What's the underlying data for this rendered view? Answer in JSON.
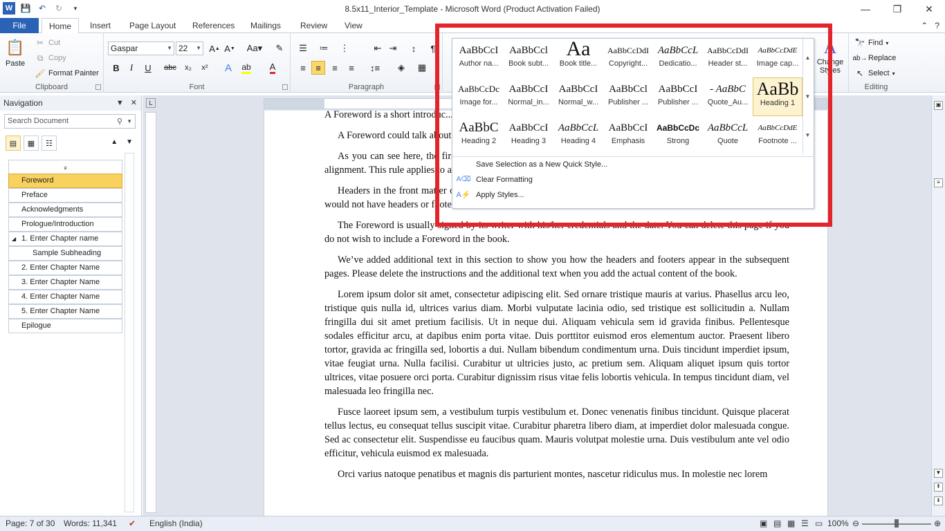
{
  "window": {
    "title": "8.5x11_Interior_Template  -  Microsoft Word (Product Activation Failed)",
    "controls": [
      "—",
      "❐",
      "✕"
    ]
  },
  "tabs": [
    "File",
    "Home",
    "Insert",
    "Page Layout",
    "References",
    "Mailings",
    "Review",
    "View"
  ],
  "ribbon": {
    "clipboard": {
      "label": "Clipboard",
      "paste": "Paste",
      "cut": "Cut",
      "copy": "Copy",
      "format_painter": "Format Painter"
    },
    "font": {
      "label": "Font",
      "family": "Gaspar",
      "size": "22",
      "bold": "B",
      "italic": "I",
      "underline": "U",
      "strike": "abc",
      "sub": "x₂",
      "sup": "x²"
    },
    "paragraph": {
      "label": "Paragraph"
    },
    "styles": {
      "change_styles": "Change Styles"
    },
    "editing": {
      "label": "Editing",
      "find": "Find",
      "replace": "Replace",
      "select": "Select"
    }
  },
  "styles_gallery": {
    "row1": [
      {
        "preview": "AaBbCcI",
        "name": "Author na..."
      },
      {
        "preview": "AaBbCcl",
        "name": "Book subt..."
      },
      {
        "preview": "Aa",
        "name": "Book title..."
      },
      {
        "preview": "AaBbCcDdI",
        "name": "Copyright..."
      },
      {
        "preview": "AaBbCcL",
        "name": "Dedicatio..."
      },
      {
        "preview": "AaBbCcDdI",
        "name": "Header st..."
      },
      {
        "preview": "AaBbCcDdE",
        "name": "Image cap..."
      }
    ],
    "row2": [
      {
        "preview": "AaBbCcDc",
        "name": "Image for..."
      },
      {
        "preview": "AaBbCcI",
        "name": "Normal_in..."
      },
      {
        "preview": "AaBbCcI",
        "name": "Normal_w..."
      },
      {
        "preview": "AaBbCcl",
        "name": "Publisher ..."
      },
      {
        "preview": "AaBbCcI",
        "name": "Publisher ..."
      },
      {
        "preview": "- AaBbC",
        "name": "Quote_Au..."
      },
      {
        "preview": "AaBb",
        "name": "Heading 1"
      }
    ],
    "row3": [
      {
        "preview": "AaBbC",
        "name": "Heading 2"
      },
      {
        "preview": "AaBbCcI",
        "name": "Heading 3"
      },
      {
        "preview": "AaBbCcL",
        "name": "Heading 4"
      },
      {
        "preview": "AaBbCcI",
        "name": "Emphasis"
      },
      {
        "preview": "AaBbCcDc",
        "name": "Strong"
      },
      {
        "preview": "AaBbCcL",
        "name": "Quote"
      },
      {
        "preview": "AaBbCcDdE",
        "name": "Footnote ..."
      }
    ],
    "menu": [
      "Save Selection as a New Quick Style...",
      "Clear Formatting",
      "Apply Styles..."
    ],
    "highlight_color": "#e3242b"
  },
  "navigation": {
    "title": "Navigation",
    "search_placeholder": "Search Document",
    "items": [
      {
        "label": "Foreword",
        "selected": true
      },
      {
        "label": "Preface"
      },
      {
        "label": "Acknowledgments"
      },
      {
        "label": "Prologue/Introduction"
      },
      {
        "label": "1. Enter Chapter name",
        "expandable": true
      },
      {
        "label": "Sample Subheading",
        "sub": true
      },
      {
        "label": "2. Enter Chapter Name"
      },
      {
        "label": "3. Enter Chapter Name"
      },
      {
        "label": "4. Enter Chapter Name"
      },
      {
        "label": "5. Enter Chapter Name"
      },
      {
        "label": "Epilogue"
      }
    ]
  },
  "document": {
    "paragraphs": [
      "A Foreword is a short introduc... Foreword is to introduce the a",
      "A Foreword could talk about ... historical impact when it was",
      "As you can see here, the first ... subsequent paragraphs are give... subheading should also be given a flush left alignment. This rule applies to all chapters in the book.",
      "Headers in the front matter of the book contain the name of the chapter alone. Pages in which the chapter starts would not have headers or footers.",
      "The Foreword is usually signed by its writer with his/her credentials and the date. You can delete this page if you do not wish to include a Foreword in the book.",
      "We’ve added additional text in this section to show you how the headers and footers appear in the subsequent pages. Please delete the instructions and the additional text when you add the actual content of the book.",
      "Lorem ipsum dolor sit amet, consectetur adipiscing elit. Sed ornare tristique mauris at varius. Phasellus arcu leo, tristique quis nulla id, ultrices varius diam. Morbi vulputate lacinia odio, sed tristique est sollicitudin a. Nullam fringilla dui sit amet pretium facilisis. Ut in neque dui. Aliquam vehicula sem id gravida finibus. Pellentesque sodales efficitur arcu, at dapibus enim porta vitae. Duis porttitor euismod eros elementum auctor. Praesent libero tortor, gravida ac fringilla sed, lobortis a dui. Nullam bibendum condimentum urna. Duis tincidunt imperdiet ipsum, vitae feugiat urna. Nulla facilisi. Curabitur ut ultricies justo, ac pretium sem. Aliquam aliquet ipsum quis tortor ultrices, vitae posuere orci porta. Curabitur dignissim risus vitae felis lobortis vehicula. In tempus tincidunt diam, vel malesuada leo fringilla nec.",
      "Fusce laoreet ipsum sem, a vestibulum turpis vestibulum et. Donec venenatis finibus tincidunt. Quisque placerat tellus lectus, eu consequat tellus suscipit vitae. Curabitur pharetra libero diam, at imperdiet dolor malesuada congue. Sed ac consectetur elit. Suspendisse eu faucibus quam. Mauris volutpat molestie urna. Duis vestibulum ante vel odio efficitur, vehicula euismod ex malesuada.",
      "Orci varius natoque penatibus et magnis dis parturient montes, nascetur ridiculus mus. In molestie nec lorem"
    ]
  },
  "statusbar": {
    "page": "Page: 7 of 30",
    "words": "Words: 11,341",
    "language": "English (India)",
    "zoom": "100%"
  }
}
